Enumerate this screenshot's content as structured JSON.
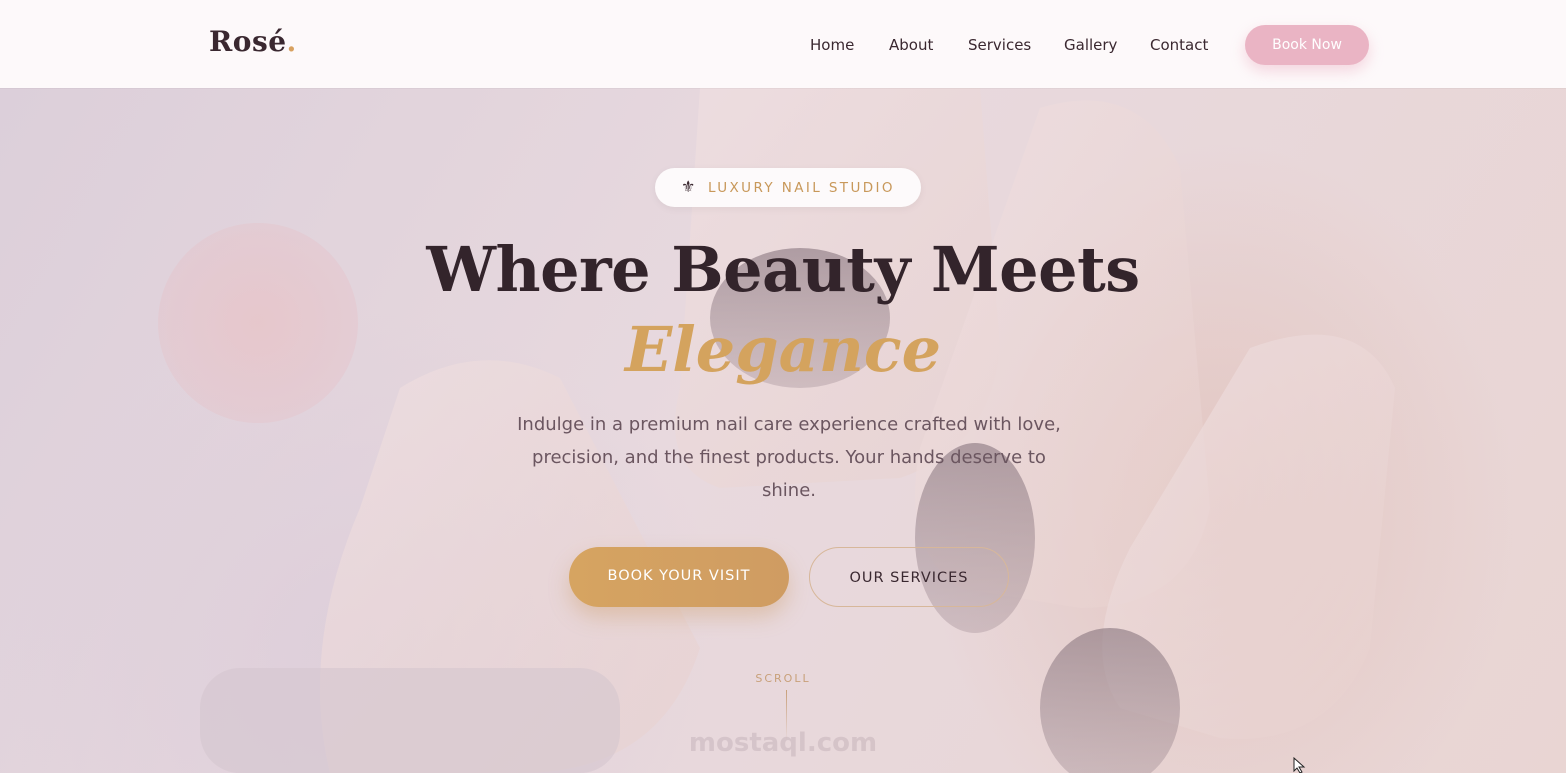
{
  "brand": {
    "name": "Rosé",
    "dot": "."
  },
  "nav": {
    "items": [
      "Home",
      "About",
      "Services",
      "Gallery",
      "Contact"
    ],
    "cta": "Book Now"
  },
  "hero": {
    "badge_icon": "sparkle-icon",
    "badge": "LUXURY NAIL STUDIO",
    "headline": "Where Beauty Meets",
    "headline_accent": "Elegance",
    "subtitle": "Indulge in a premium nail care experience crafted with love, precision, and the finest products. Your hands deserve to shine.",
    "primary_button": "BOOK YOUR VISIT",
    "secondary_button": "OUR SERVICES",
    "scroll_label": "SCROLL"
  },
  "watermark": "mostaql.com",
  "colors": {
    "accent_gold": "#d4a35e",
    "accent_pink": "#eab4c4",
    "text_dark": "#33242b"
  }
}
